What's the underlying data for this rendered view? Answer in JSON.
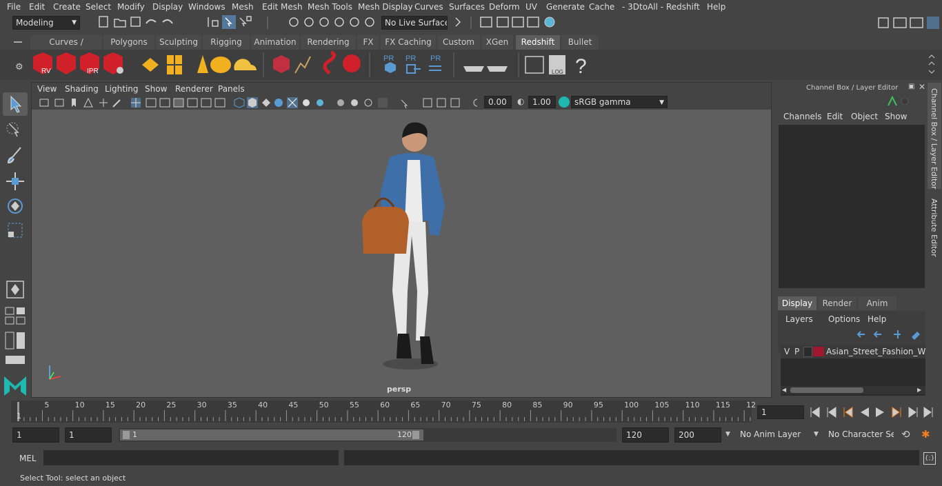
{
  "menu": [
    "File",
    "Edit",
    "Create",
    "Select",
    "Modify",
    "Display",
    "Windows",
    "Mesh",
    "Edit Mesh",
    "Mesh Tools",
    "Mesh Display",
    "Curves",
    "Surfaces",
    "Deform",
    "UV",
    "Generate",
    "Cache",
    "- 3DtoAll -",
    "Redshift",
    "Help"
  ],
  "status": {
    "mode": "Modeling",
    "live_surface": "No Live Surface"
  },
  "shelf_tabs": [
    "Curves / Surfaces",
    "Polygons",
    "Sculpting",
    "Rigging",
    "Animation",
    "Rendering",
    "FX",
    "FX Caching",
    "Custom",
    "XGen",
    "Redshift",
    "Bullet"
  ],
  "shelf_active": "Redshift",
  "shelf_labels": {
    "rv": "RV",
    "ipr": "IPR",
    "pr1": "PR",
    "pr2": "PR",
    "pr3": "PR",
    "log": "LOG",
    "help": "?"
  },
  "viewport": {
    "menu": [
      "View",
      "Shading",
      "Lighting",
      "Show",
      "Renderer",
      "Panels"
    ],
    "exposure": "0.00",
    "gamma": "1.00",
    "color_space": "sRGB gamma",
    "camera": "persp"
  },
  "channel_box": {
    "title": "Channel Box / Layer Editor",
    "menu": [
      "Channels",
      "Edit",
      "Object",
      "Show"
    ],
    "layer_tabs": [
      "Display",
      "Render",
      "Anim"
    ],
    "layer_active": "Display",
    "layer_menu": [
      "Layers",
      "Options",
      "Help"
    ],
    "layer": {
      "v": "V",
      "p": "P",
      "name": "Asian_Street_Fashion_Wom",
      "color": "#a01830"
    }
  },
  "side_tabs": {
    "channel": "Channel Box / Layer Editor",
    "attribute": "Attribute Editor"
  },
  "timeline": {
    "start_tick": "1",
    "ticks": [
      "5",
      "10",
      "15",
      "20",
      "25",
      "30",
      "35",
      "40",
      "45",
      "50",
      "55",
      "60",
      "65",
      "70",
      "75",
      "80",
      "85",
      "90",
      "95",
      "100",
      "105",
      "110",
      "115",
      "12"
    ],
    "current_frame": "1"
  },
  "range": {
    "start": "1",
    "playback_start": "1",
    "slider_start": "1",
    "slider_end": "120",
    "playback_end": "120",
    "end": "200",
    "anim_layer": "No Anim Layer",
    "char_set": "No Character Set"
  },
  "cmd": {
    "label": "MEL"
  },
  "help_line": "Select Tool: select an object",
  "colors": {
    "active_tab": "#5d5d5d",
    "redshift_red": "#d0202a",
    "accent_blue": "#5b9bd5",
    "layer_red": "#a01830"
  }
}
